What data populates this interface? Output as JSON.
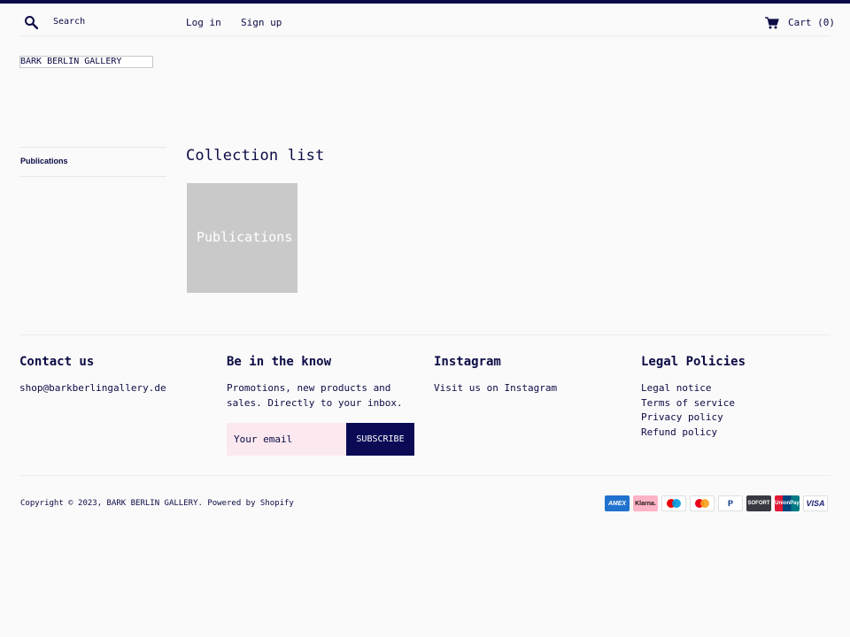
{
  "header": {
    "search_placeholder": "Search",
    "login_label": "Log in",
    "signup_label": "Sign up",
    "cart_label": "Cart (0)",
    "accent_color": "#0a0a4a"
  },
  "logo": {
    "text": "BARK BERLIN GALLERY"
  },
  "sidebar": {
    "items": [
      {
        "label": "Publications"
      }
    ]
  },
  "main": {
    "title": "Collection list",
    "collections": [
      {
        "label": "Publications",
        "color": "#c9c9c9"
      }
    ]
  },
  "footer": {
    "contact": {
      "heading": "Contact us",
      "email": "shop@barkberlingallery.de"
    },
    "newsletter": {
      "heading": "Be in the know",
      "text": "Promotions, new products and sales. Directly to your inbox.",
      "email_placeholder": "Your email",
      "subscribe_label": "SUBSCRIBE"
    },
    "instagram": {
      "heading": "Instagram",
      "link": "Visit us on Instagram"
    },
    "legal": {
      "heading": "Legal Policies",
      "links": [
        "Legal notice",
        "Terms of service",
        "Privacy policy",
        "Refund policy"
      ]
    },
    "copyright": "Copyright © 2023, BARK BERLIN GALLERY. Powered by Shopify",
    "payment_icons": [
      "amex-icon",
      "klarna-icon",
      "maestro-icon",
      "mastercard-icon",
      "paypal-icon",
      "sofort-icon",
      "unionpay-icon",
      "visa-icon"
    ],
    "payment_labels": {
      "amex": "AMEX",
      "klarna": "Klarna.",
      "paypal": "P",
      "sofort": "SOFORT",
      "unionpay": "UnionPay",
      "visa": "VISA"
    }
  }
}
